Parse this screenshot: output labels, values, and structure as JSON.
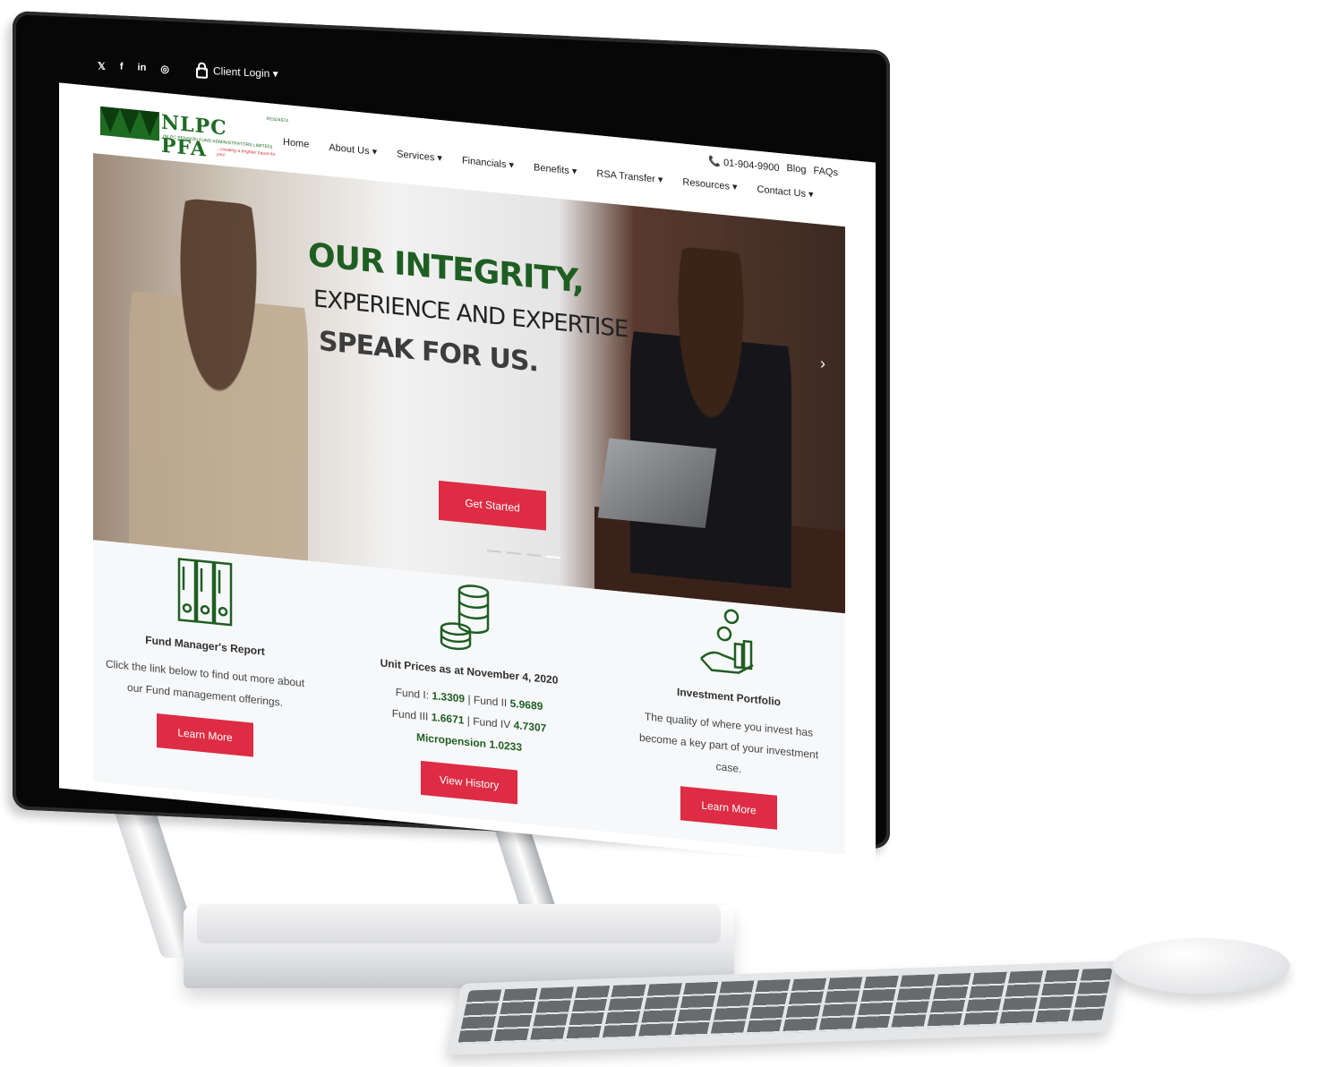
{
  "topbar": {
    "social": [
      "twitter-icon",
      "facebook-icon",
      "linkedin-icon",
      "instagram-icon"
    ],
    "social_glyphs": [
      "𝕏",
      "f",
      "in",
      "◎"
    ],
    "client_login": "Client Login ▾"
  },
  "header": {
    "logo_text": "NLPC PFA",
    "logo_sub": "(NLPC PENSION FUND ADMINISTRATORS LIMITED)",
    "logo_tag": "...creating a brighter future for you!",
    "logo_rc": "RC624974",
    "phone": "📞 01-904-9900",
    "blog": "Blog",
    "faqs": "FAQs",
    "nav": [
      "Home",
      "About Us ▾",
      "Services ▾",
      "Financials ▾",
      "Benefits ▾",
      "RSA Transfer ▾",
      "Resources ▾",
      "Contact Us ▾"
    ]
  },
  "hero": {
    "line1": "OUR INTEGRITY,",
    "line2": "EXPERIENCE AND EXPERTISE",
    "line3": "SPEAK FOR US.",
    "cta": "Get Started",
    "next": "›",
    "slides_count": 4,
    "active_slide": 4
  },
  "features": {
    "fund_report": {
      "title": "Fund Manager's Report",
      "text": "Click the link below to find out more about our Fund management offerings.",
      "button": "Learn More"
    },
    "unit_prices": {
      "title": "Unit Prices as at November 4, 2020",
      "fund1_label": "Fund I:",
      "fund1": "1.3309",
      "fund2_label": "| Fund II",
      "fund2": "5.9689",
      "fund3_label": "Fund III",
      "fund3": "1.6671",
      "fund4_label": "| Fund IV",
      "fund4": "4.7307",
      "micro_label": "Micropension",
      "micro": "1.0233",
      "button": "View History"
    },
    "portfolio": {
      "title": "Investment Portfolio",
      "text": "The quality of where you invest has become a key part of your investment case.",
      "button": "Learn More"
    }
  },
  "colors": {
    "brand_green": "#1f5e22",
    "accent_red": "#dd2c43"
  }
}
